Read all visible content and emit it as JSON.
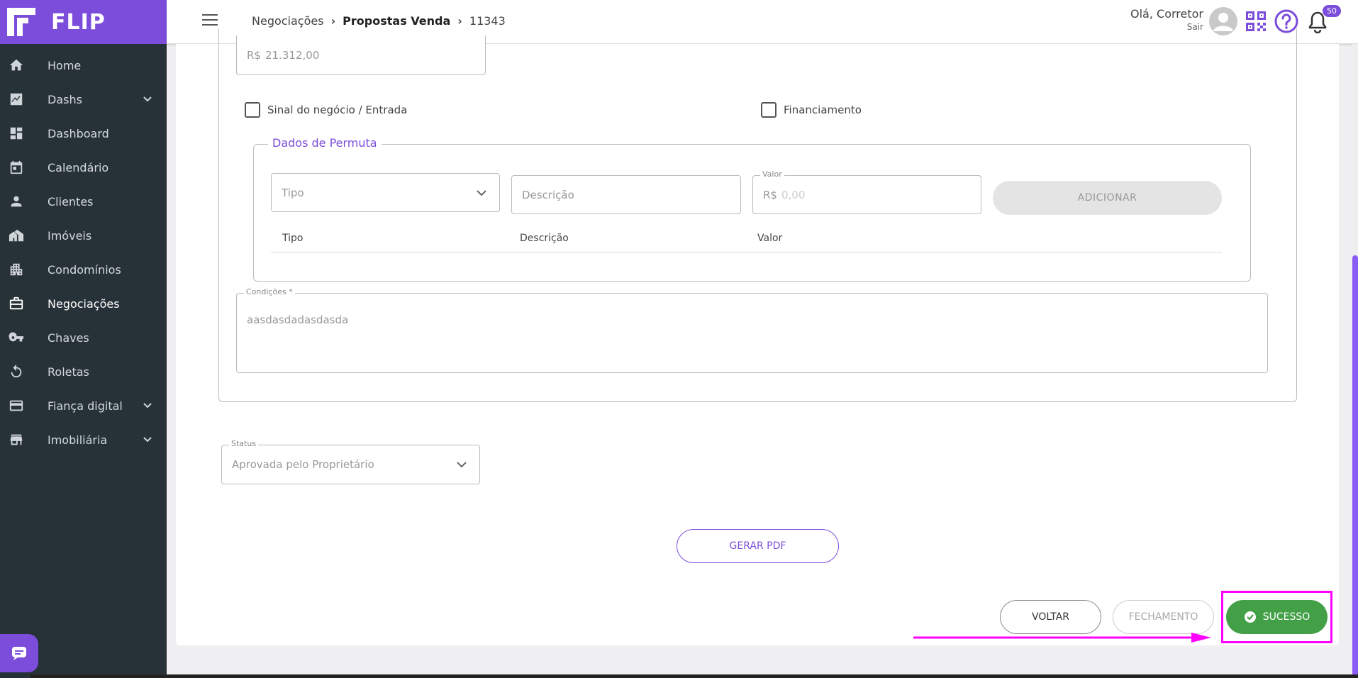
{
  "brand": {
    "name": "FLIP",
    "accent": "#7c4ddb"
  },
  "sidebar": {
    "items": [
      {
        "label": "Home",
        "icon": "home-icon"
      },
      {
        "label": "Dashs",
        "icon": "chart-icon",
        "expandable": true
      },
      {
        "label": "Dashboard",
        "icon": "dashboard-icon"
      },
      {
        "label": "Calendário",
        "icon": "calendar-icon"
      },
      {
        "label": "Clientes",
        "icon": "person-icon"
      },
      {
        "label": "Imóveis",
        "icon": "building-icon"
      },
      {
        "label": "Condomínios",
        "icon": "apartment-icon"
      },
      {
        "label": "Negociações",
        "icon": "briefcase-icon",
        "active": true
      },
      {
        "label": "Chaves",
        "icon": "key-icon"
      },
      {
        "label": "Roletas",
        "icon": "refresh-icon"
      },
      {
        "label": "Fiança digital",
        "icon": "card-icon",
        "expandable": true
      },
      {
        "label": "Imobiliária",
        "icon": "store-icon",
        "expandable": true
      }
    ]
  },
  "header": {
    "breadcrumb": [
      "Negociações",
      "Propostas Venda",
      "11343"
    ],
    "greeting": "Olá, Corretor",
    "logout": "Sair",
    "notifications": "50"
  },
  "form": {
    "top_value": {
      "prefix": "R$",
      "value": "21.312,00"
    },
    "checkbox_sinal": "Sinal do negócio / Entrada",
    "checkbox_financiamento": "Financiamento",
    "permuta": {
      "legend": "Dados de Permuta",
      "tipo_placeholder": "Tipo",
      "descricao_placeholder": "Descrição",
      "valor_label": "Valor",
      "valor_prefix": "R$",
      "valor_placeholder": "0,00",
      "add_button": "ADICIONAR",
      "columns": [
        "Tipo",
        "Descrição",
        "Valor"
      ]
    },
    "condicoes": {
      "label": "Condições *",
      "value": "aasdasdadasdasda"
    },
    "status": {
      "label": "Status",
      "value": "Aprovada pelo Proprietário"
    }
  },
  "actions": {
    "pdf": "GERAR PDF",
    "voltar": "VOLTAR",
    "fechamento": "FECHAMENTO",
    "sucesso": "SUCESSO"
  },
  "colors": {
    "success": "#43a047",
    "highlight": "#ff00ff",
    "sidebar_bg": "#263238"
  }
}
